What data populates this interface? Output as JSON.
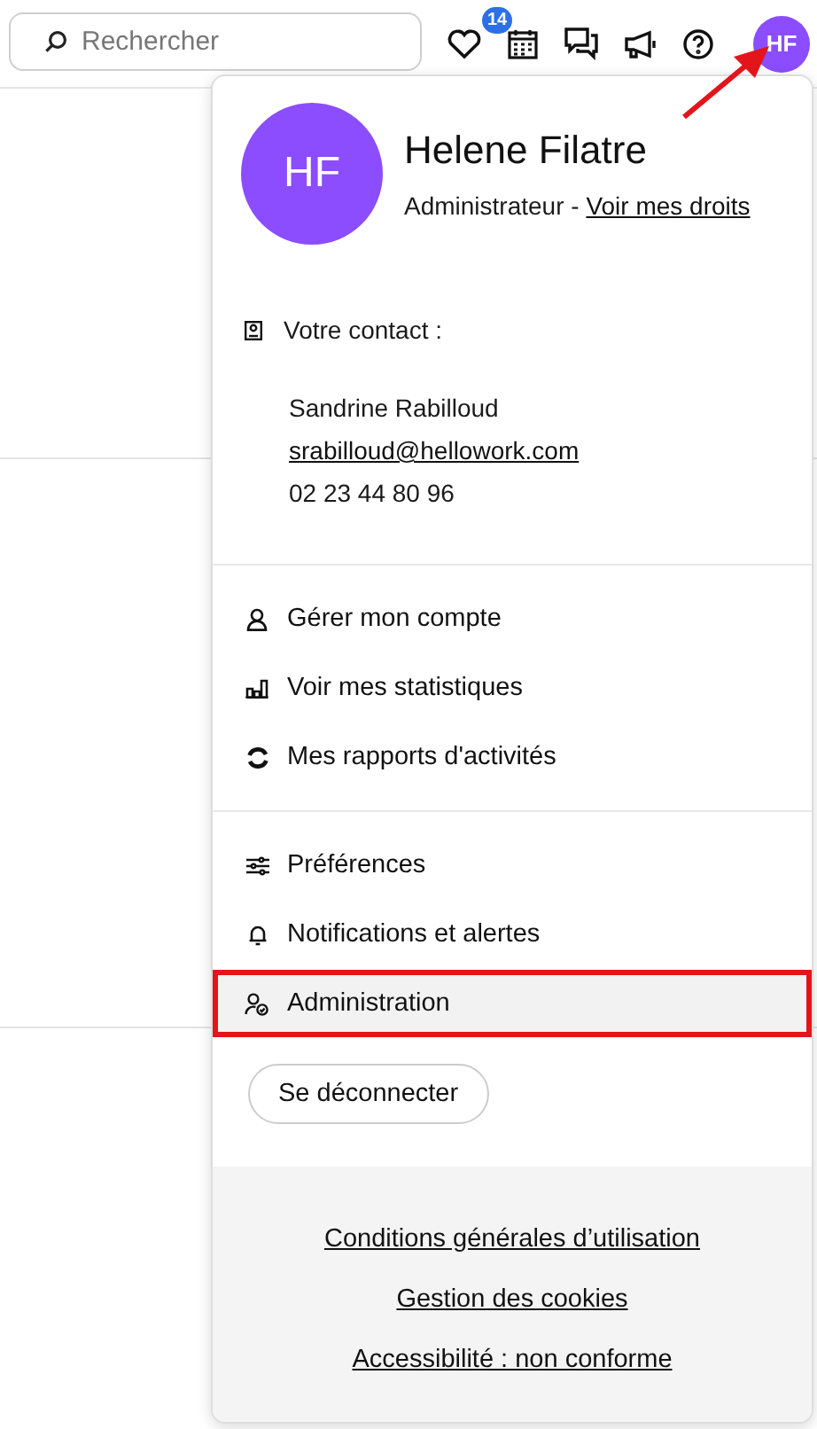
{
  "search": {
    "placeholder": "Rechercher"
  },
  "toolbar": {
    "favorites_badge": "14",
    "avatar_initials": "HF"
  },
  "user": {
    "initials": "HF",
    "name": "Helene Filatre",
    "role": "Administrateur - ",
    "rights_link": "Voir mes droits"
  },
  "contact": {
    "label": "Votre contact :",
    "name": "Sandrine Rabilloud",
    "email": "srabilloud@hellowork.com",
    "phone": "02 23 44 80 96"
  },
  "menu_sections": [
    {
      "items": [
        {
          "label": "Gérer mon compte",
          "highlighted": false,
          "annotated": false
        },
        {
          "label": "Voir mes statistiques",
          "highlighted": false,
          "annotated": false
        },
        {
          "label": "Mes rapports d'activités",
          "highlighted": false,
          "annotated": false
        }
      ]
    },
    {
      "items": [
        {
          "label": "Préférences",
          "highlighted": false,
          "annotated": false
        },
        {
          "label": "Notifications et alertes",
          "highlighted": false,
          "annotated": false
        },
        {
          "label": "Administration",
          "highlighted": true,
          "annotated": true
        }
      ]
    }
  ],
  "logout_button": "Se déconnecter",
  "footer_links": [
    "Conditions générales d’utilisation",
    "Gestion des cookies",
    "Accessibilité : non conforme"
  ],
  "annotation_arrow": true
}
